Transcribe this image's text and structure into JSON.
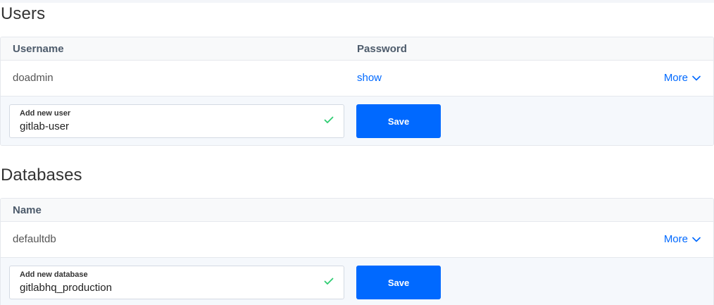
{
  "users": {
    "title": "Users",
    "columns": {
      "username": "Username",
      "password": "Password"
    },
    "rows": [
      {
        "username": "doadmin",
        "password_action": "show",
        "more_label": "More"
      }
    ],
    "add": {
      "label": "Add new user",
      "value": "gitlab-user",
      "save_label": "Save"
    }
  },
  "databases": {
    "title": "Databases",
    "columns": {
      "name": "Name"
    },
    "rows": [
      {
        "name": "defaultdb",
        "more_label": "More"
      }
    ],
    "add": {
      "label": "Add new database",
      "value": "gitlabhq_production",
      "save_label": "Save"
    }
  },
  "colors": {
    "accent": "#0069ff",
    "valid": "#2ecc71",
    "header_bg": "#f8f9fa",
    "add_row_bg": "#f5f8fc"
  },
  "icons": {
    "more": "chevron-down-icon",
    "valid": "checkmark-icon"
  }
}
